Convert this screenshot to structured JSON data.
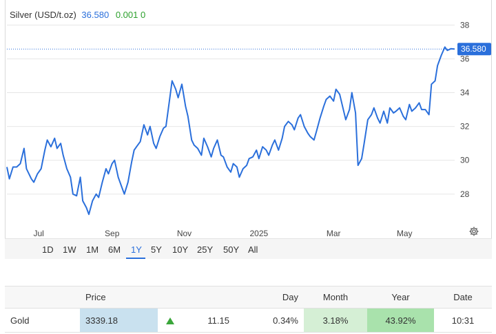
{
  "legend": {
    "label": "Silver (USD/t.oz)",
    "value": "36.580",
    "change": "0.001 0"
  },
  "price_tag": "36.580",
  "range_buttons": [
    "1D",
    "1W",
    "1M",
    "6M",
    "1Y",
    "5Y",
    "10Y",
    "25Y",
    "50Y",
    "All"
  ],
  "active_range": "1Y",
  "colors": {
    "line": "#2a6fdb",
    "positive": "#2e8b2e",
    "price_bg": "#c9e1ef"
  },
  "chart_data": {
    "type": "line",
    "title": "Silver (USD/t.oz)",
    "xlabel": "",
    "ylabel": "",
    "x_ticks": [
      "Jul",
      "Sep",
      "Nov",
      "2025",
      "Mar",
      "May"
    ],
    "y_ticks": [
      28,
      30,
      32,
      34,
      36,
      38
    ],
    "ylim": [
      26.2,
      39.4
    ],
    "y_axis_side": "right",
    "grid": true,
    "last_value": 36.58,
    "x_range": [
      "2024-06-12",
      "2025-06-13"
    ],
    "series": [
      {
        "name": "",
        "points": [
          [
            "2024-06-12",
            29.6
          ],
          [
            "2024-06-14",
            28.9
          ],
          [
            "2024-06-17",
            29.6
          ],
          [
            "2024-06-20",
            29.6
          ],
          [
            "2024-06-23",
            29.8
          ],
          [
            "2024-06-26",
            30.7
          ],
          [
            "2024-06-28",
            29.5
          ],
          [
            "2024-07-02",
            28.9
          ],
          [
            "2024-07-04",
            28.7
          ],
          [
            "2024-07-07",
            29.2
          ],
          [
            "2024-07-10",
            29.5
          ],
          [
            "2024-07-13",
            30.6
          ],
          [
            "2024-07-15",
            31.2
          ],
          [
            "2024-07-18",
            30.8
          ],
          [
            "2024-07-21",
            31.3
          ],
          [
            "2024-07-23",
            30.7
          ],
          [
            "2024-07-26",
            31.0
          ],
          [
            "2024-07-28",
            30.3
          ],
          [
            "2024-07-31",
            29.5
          ],
          [
            "2024-08-03",
            29.0
          ],
          [
            "2024-08-05",
            28.0
          ],
          [
            "2024-08-08",
            27.9
          ],
          [
            "2024-08-11",
            29.0
          ],
          [
            "2024-08-13",
            27.6
          ],
          [
            "2024-08-16",
            27.2
          ],
          [
            "2024-08-18",
            26.8
          ],
          [
            "2024-08-21",
            27.6
          ],
          [
            "2024-08-24",
            28.0
          ],
          [
            "2024-08-26",
            27.8
          ],
          [
            "2024-08-29",
            28.7
          ],
          [
            "2024-09-01",
            29.5
          ],
          [
            "2024-09-03",
            29.2
          ],
          [
            "2024-09-06",
            29.8
          ],
          [
            "2024-09-08",
            30.0
          ],
          [
            "2024-09-11",
            29.0
          ],
          [
            "2024-09-14",
            28.4
          ],
          [
            "2024-09-16",
            28.0
          ],
          [
            "2024-09-19",
            28.7
          ],
          [
            "2024-09-22",
            29.9
          ],
          [
            "2024-09-24",
            30.6
          ],
          [
            "2024-09-27",
            30.9
          ],
          [
            "2024-09-29",
            31.1
          ],
          [
            "2024-10-02",
            32.1
          ],
          [
            "2024-10-05",
            31.5
          ],
          [
            "2024-10-07",
            32.0
          ],
          [
            "2024-10-10",
            31.0
          ],
          [
            "2024-10-12",
            30.7
          ],
          [
            "2024-10-15",
            31.4
          ],
          [
            "2024-10-18",
            31.9
          ],
          [
            "2024-10-20",
            32.0
          ],
          [
            "2024-10-23",
            33.6
          ],
          [
            "2024-10-25",
            34.7
          ],
          [
            "2024-10-28",
            34.2
          ],
          [
            "2024-10-30",
            33.7
          ],
          [
            "2024-11-02",
            34.5
          ],
          [
            "2024-11-05",
            33.2
          ],
          [
            "2024-11-07",
            32.6
          ],
          [
            "2024-11-10",
            31.2
          ],
          [
            "2024-11-12",
            30.9
          ],
          [
            "2024-11-15",
            30.7
          ],
          [
            "2024-11-18",
            30.3
          ],
          [
            "2024-11-20",
            31.3
          ],
          [
            "2024-11-23",
            30.8
          ],
          [
            "2024-11-26",
            30.2
          ],
          [
            "2024-11-28",
            30.7
          ],
          [
            "2024-12-01",
            31.2
          ],
          [
            "2024-12-04",
            30.3
          ],
          [
            "2024-12-06",
            30.2
          ],
          [
            "2024-12-09",
            29.6
          ],
          [
            "2024-12-12",
            29.3
          ],
          [
            "2024-12-14",
            29.8
          ],
          [
            "2024-12-17",
            29.6
          ],
          [
            "2024-12-19",
            29.0
          ],
          [
            "2024-12-22",
            29.5
          ],
          [
            "2024-12-25",
            29.7
          ],
          [
            "2024-12-27",
            30.1
          ],
          [
            "2024-12-30",
            30.2
          ],
          [
            "2025-01-02",
            30.6
          ],
          [
            "2025-01-04",
            30.1
          ],
          [
            "2025-01-07",
            30.8
          ],
          [
            "2025-01-10",
            30.6
          ],
          [
            "2025-01-12",
            30.3
          ],
          [
            "2025-01-15",
            30.9
          ],
          [
            "2025-01-17",
            31.2
          ],
          [
            "2025-01-20",
            30.6
          ],
          [
            "2025-01-23",
            31.3
          ],
          [
            "2025-01-25",
            32.0
          ],
          [
            "2025-01-28",
            32.3
          ],
          [
            "2025-01-31",
            32.1
          ],
          [
            "2025-02-02",
            31.8
          ],
          [
            "2025-02-05",
            32.5
          ],
          [
            "2025-02-07",
            32.7
          ],
          [
            "2025-02-10",
            32.0
          ],
          [
            "2025-02-13",
            31.6
          ],
          [
            "2025-02-15",
            31.4
          ],
          [
            "2025-02-18",
            31.2
          ],
          [
            "2025-02-20",
            31.7
          ],
          [
            "2025-02-23",
            32.5
          ],
          [
            "2025-02-26",
            33.2
          ],
          [
            "2025-02-28",
            33.6
          ],
          [
            "2025-03-03",
            33.8
          ],
          [
            "2025-03-06",
            33.5
          ],
          [
            "2025-03-08",
            34.2
          ],
          [
            "2025-03-11",
            33.9
          ],
          [
            "2025-03-13",
            33.3
          ],
          [
            "2025-03-16",
            32.4
          ],
          [
            "2025-03-19",
            33.0
          ],
          [
            "2025-03-21",
            34.0
          ],
          [
            "2025-03-24",
            32.8
          ],
          [
            "2025-03-26",
            29.7
          ],
          [
            "2025-03-29",
            30.1
          ],
          [
            "2025-03-31",
            31.0
          ],
          [
            "2025-04-03",
            32.4
          ],
          [
            "2025-04-06",
            32.7
          ],
          [
            "2025-04-08",
            33.1
          ],
          [
            "2025-04-11",
            32.5
          ],
          [
            "2025-04-13",
            32.2
          ],
          [
            "2025-04-16",
            32.9
          ],
          [
            "2025-04-19",
            32.2
          ],
          [
            "2025-04-21",
            33.1
          ],
          [
            "2025-04-24",
            32.8
          ],
          [
            "2025-04-26",
            32.9
          ],
          [
            "2025-04-29",
            33.1
          ],
          [
            "2025-05-02",
            32.6
          ],
          [
            "2025-05-04",
            32.4
          ],
          [
            "2025-05-07",
            33.3
          ],
          [
            "2025-05-09",
            32.9
          ],
          [
            "2025-05-12",
            33.1
          ],
          [
            "2025-05-15",
            33.4
          ],
          [
            "2025-05-17",
            33.0
          ],
          [
            "2025-05-20",
            33.0
          ],
          [
            "2025-05-23",
            32.7
          ],
          [
            "2025-05-25",
            34.5
          ],
          [
            "2025-05-28",
            34.7
          ],
          [
            "2025-05-30",
            35.6
          ],
          [
            "2025-06-02",
            36.2
          ],
          [
            "2025-06-05",
            36.7
          ],
          [
            "2025-06-07",
            36.5
          ],
          [
            "2025-06-10",
            36.6
          ],
          [
            "2025-06-13",
            36.58
          ]
        ]
      }
    ]
  },
  "table": {
    "headers": [
      "",
      "Price",
      "",
      "",
      "Day",
      "Month",
      "Year",
      "Date"
    ],
    "row": {
      "name": "Gold",
      "price": "3339.18",
      "change": "11.15",
      "day": "0.34%",
      "month": "3.18%",
      "year": "43.92%",
      "date": "10:31"
    }
  }
}
